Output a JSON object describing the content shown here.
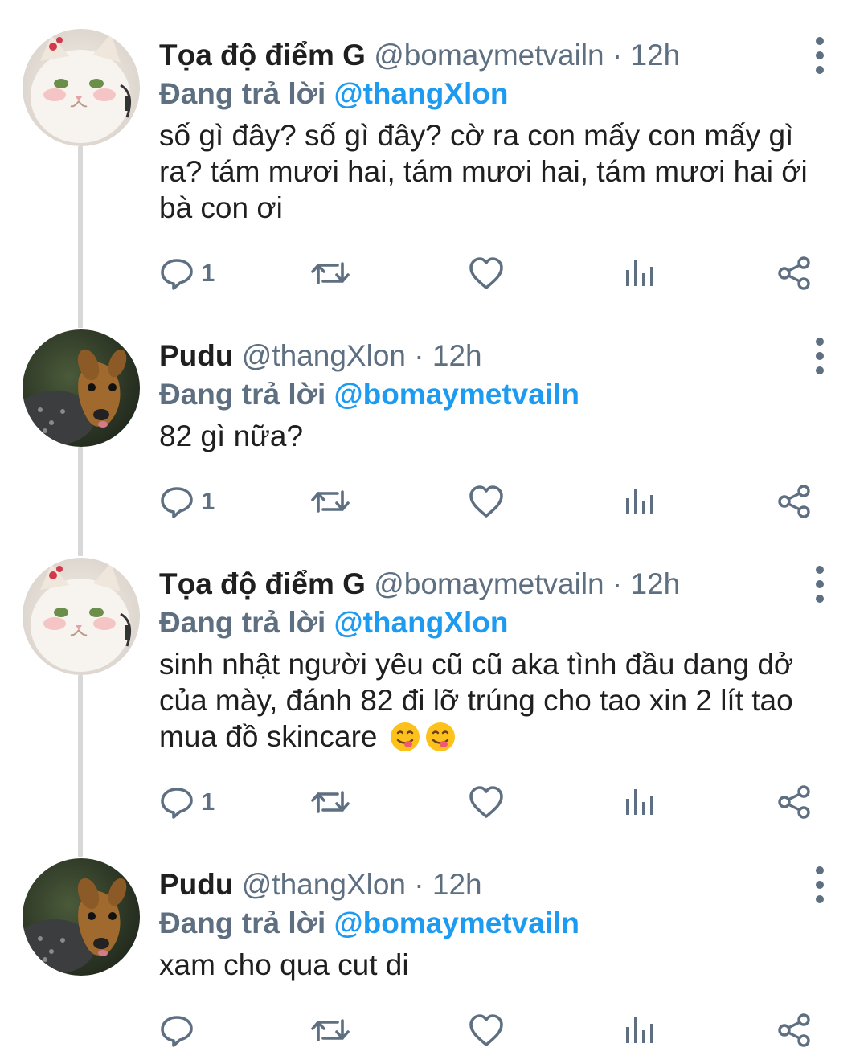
{
  "tweets": [
    {
      "name": "Tọa độ điểm G",
      "handle": "@bomaymetvailn",
      "separator": "·",
      "time": "12h",
      "reply_prefix": "Đang trả lời",
      "reply_to": "@thangXlon",
      "text": "số gì đây? số gì đây? cờ ra con mấy con mấy gì ra? tám mươi hai, tám mươi hai, tám mươi hai ới bà con ơi",
      "reply_count": "1",
      "avatar": "white-cat-avatar"
    },
    {
      "name": "Pudu",
      "handle": "@thangXlon",
      "separator": "·",
      "time": "12h",
      "reply_prefix": "Đang trả lời",
      "reply_to": "@bomaymetvailn",
      "text": "82 gì nữa?",
      "reply_count": "1",
      "avatar": "pudu-deer-avatar"
    },
    {
      "name": "Tọa độ điểm G",
      "handle": "@bomaymetvailn",
      "separator": "·",
      "time": "12h",
      "reply_prefix": "Đang trả lời",
      "reply_to": "@thangXlon",
      "text": "sinh nhật người yêu cũ cũ aka tình đầu dang dở của mày, đánh 82 đi lỡ trúng cho tao xin 2 lít tao mua đồ skincare",
      "emoji": [
        "face-savoring-food-emoji",
        "face-savoring-food-emoji"
      ],
      "reply_count": "1",
      "avatar": "white-cat-avatar"
    },
    {
      "name": "Pudu",
      "handle": "@thangXlon",
      "separator": "·",
      "time": "12h",
      "reply_prefix": "Đang trả lời",
      "reply_to": "@bomaymetvailn",
      "text": "xam cho qua cut di",
      "reply_count": "",
      "avatar": "pudu-deer-avatar"
    }
  ],
  "icons": {
    "reply": "reply-bubble-icon",
    "retweet": "retweet-icon",
    "like": "heart-icon",
    "views": "views-bar-chart-icon",
    "share": "share-icon",
    "more": "more-vertical-icon"
  },
  "colors": {
    "text": "#1f1f1f",
    "secondary": "#5d6f80",
    "link": "#1d9bf0",
    "thread_line": "#d8d8d8",
    "background": "#ffffff"
  }
}
